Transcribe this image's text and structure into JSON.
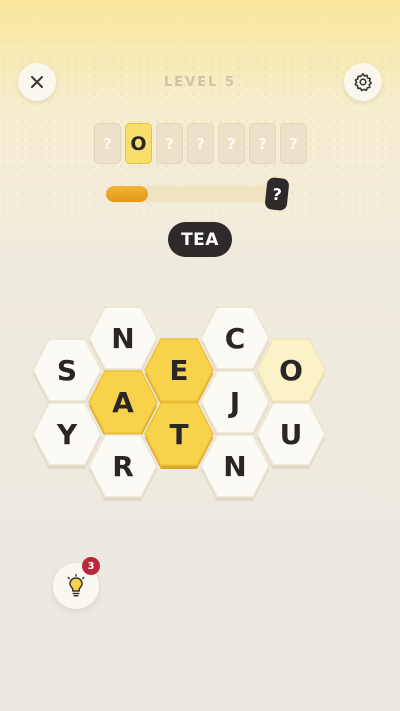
{
  "header": {
    "level_label": "LEVEL 5"
  },
  "answer": {
    "slots": [
      "?",
      "O",
      "?",
      "?",
      "?",
      "?",
      "?"
    ],
    "filled_index": 1
  },
  "progress": {
    "fraction": 0.24,
    "end_label": "?"
  },
  "current_word": "TEA",
  "board": {
    "tiles": [
      {
        "letter": "N",
        "state": "normal",
        "col": 2,
        "row": 0
      },
      {
        "letter": "C",
        "state": "normal",
        "col": 4,
        "row": 0
      },
      {
        "letter": "S",
        "state": "normal",
        "col": 1,
        "row": 1
      },
      {
        "letter": "E",
        "state": "selected",
        "col": 3,
        "row": 1
      },
      {
        "letter": "O",
        "state": "highlight",
        "col": 5,
        "row": 1
      },
      {
        "letter": "A",
        "state": "selected",
        "col": 2,
        "row": 2
      },
      {
        "letter": "J",
        "state": "normal",
        "col": 4,
        "row": 2
      },
      {
        "letter": "Y",
        "state": "normal",
        "col": 1,
        "row": 3
      },
      {
        "letter": "T",
        "state": "selected",
        "col": 3,
        "row": 3
      },
      {
        "letter": "U",
        "state": "normal",
        "col": 5,
        "row": 3
      },
      {
        "letter": "R",
        "state": "normal",
        "col": 2,
        "row": 4
      },
      {
        "letter": "N",
        "state": "normal",
        "col": 4,
        "row": 4
      }
    ]
  },
  "hints": {
    "count": "3",
    "icon": "lightbulb-icon"
  },
  "colors": {
    "tile_normal": "#fcfaf5",
    "tile_selected": "#f7d24a",
    "tile_highlight": "#fbf2c8",
    "accent": "#e39818",
    "dark": "#2e2a2a"
  }
}
